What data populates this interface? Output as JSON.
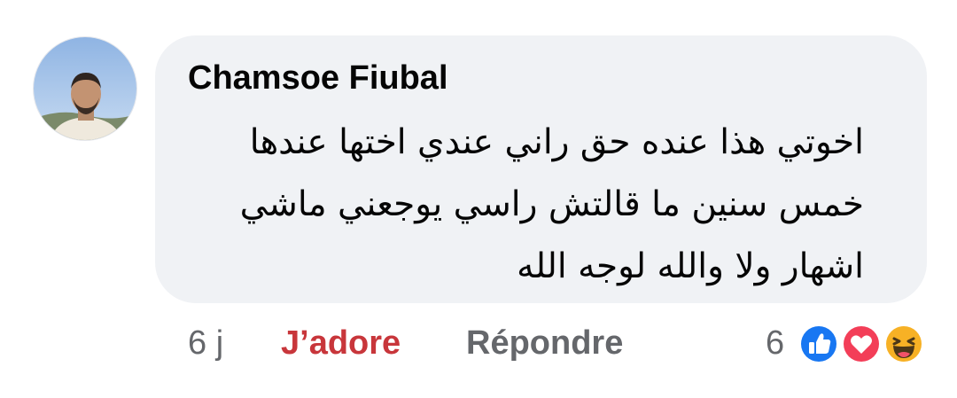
{
  "comment": {
    "author": "Chamsoe Fiubal",
    "text": "اخوتي هذا عنده حق راني عندي اختها عندها خمس سنين ما قالتش راسي يوجعني ماشي اشهار ولا والله لوجه الله",
    "avatar_icon": "profile-photo"
  },
  "actions": {
    "time": "6 j",
    "like_label": "J’adore",
    "like_color": "#c8363b",
    "reply_label": "Répondre"
  },
  "reactions": {
    "count": "6",
    "icons": [
      "like-icon",
      "love-icon",
      "haha-icon"
    ]
  },
  "colors": {
    "bubble": "#f0f2f5",
    "text": "#050505",
    "muted": "#65676b",
    "like_blue": "#1877f2",
    "love_red": "#f33e58",
    "haha_yellow": "#f7b125"
  }
}
